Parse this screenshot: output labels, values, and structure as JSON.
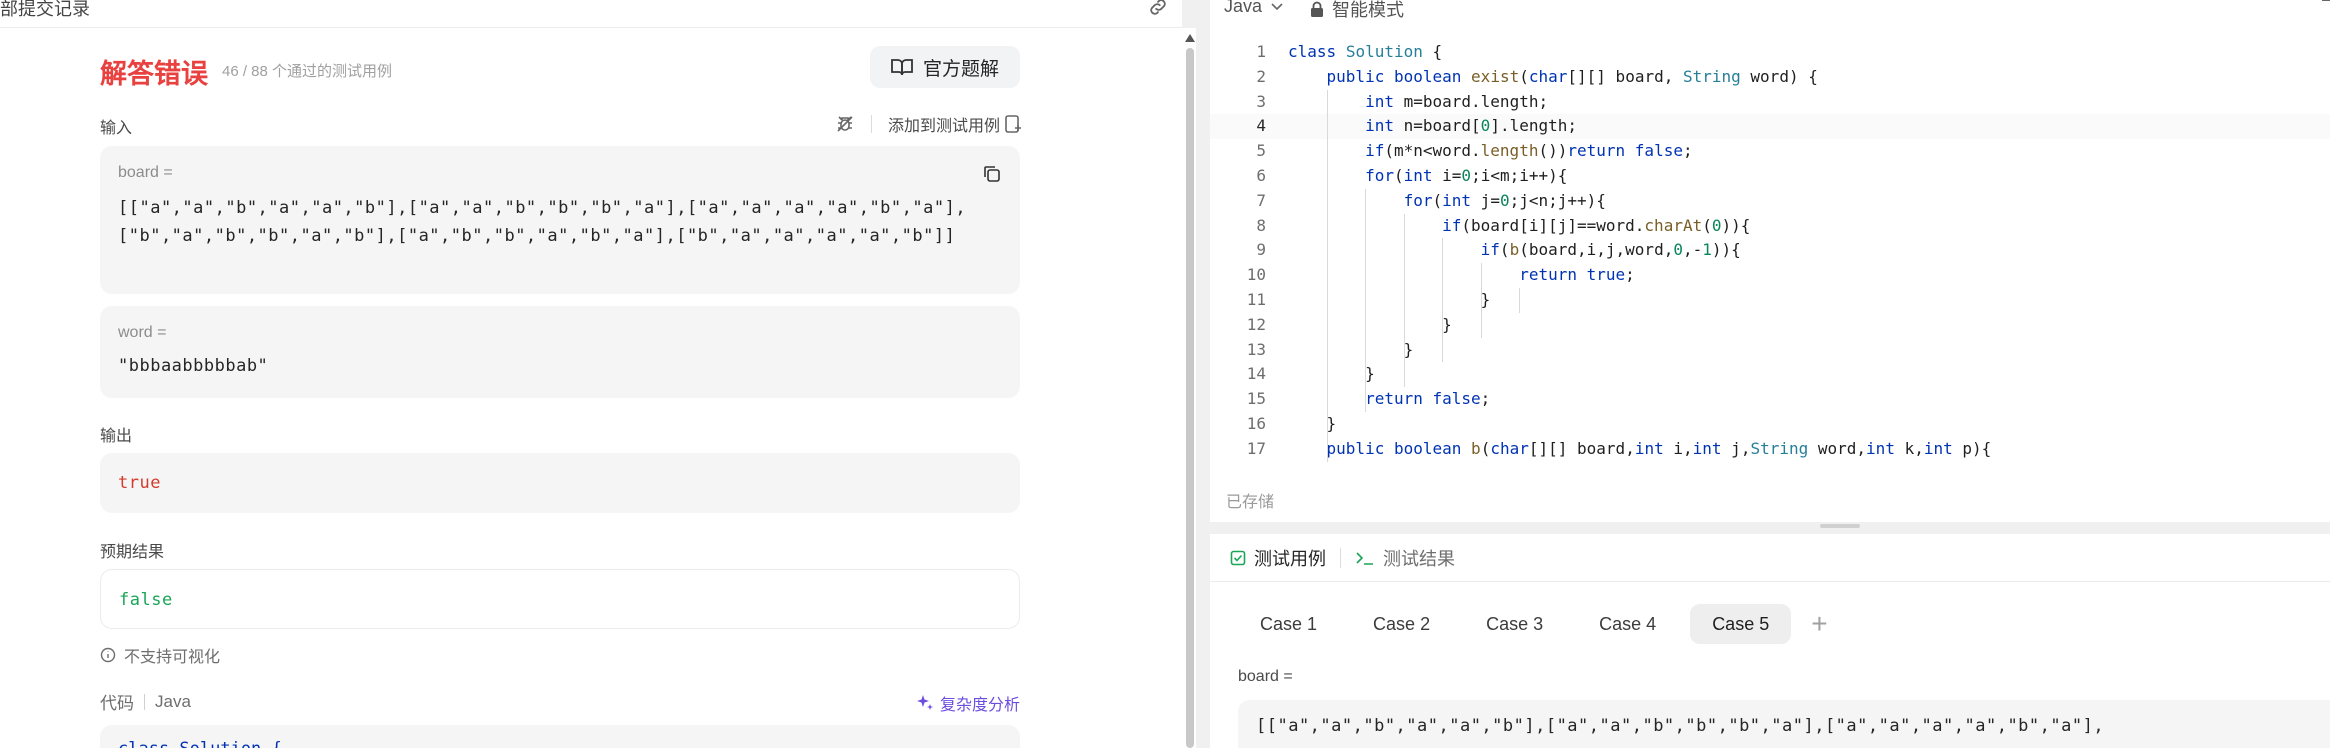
{
  "left": {
    "breadcrumb": "部提交记录",
    "result_title": "解答错误",
    "result_count": "46 / 88 个通过的测试用例",
    "solution_button": "官方题解",
    "input_label": "输入",
    "add_testcase": "添加到测试用例",
    "board_label": "board =",
    "board_value": "[[\"a\",\"a\",\"b\",\"a\",\"a\",\"b\"],[\"a\",\"a\",\"b\",\"b\",\"b\",\"a\"],[\"a\",\"a\",\"a\",\"a\",\"b\",\"a\"],[\"b\",\"a\",\"b\",\"b\",\"a\",\"b\"],[\"a\",\"b\",\"b\",\"a\",\"b\",\"a\"],[\"b\",\"a\",\"a\",\"a\",\"a\",\"b\"]]",
    "word_label": "word =",
    "word_value": "\"bbbaabbbbbab\"",
    "output_label": "输出",
    "output_value": "true",
    "expected_label": "预期结果",
    "expected_value": "false",
    "no_visual": "不支持可视化",
    "code_label": "代码",
    "code_lang": "Java",
    "complexity": "复杂度分析",
    "code_peek": "class Solution {"
  },
  "editor": {
    "language": "Java",
    "mode": "智能模式",
    "saved": "已存储",
    "active_line": 4,
    "lines": [
      {
        "n": "1",
        "html": "<span class=\"kw\">class</span> <span class=\"ty\">Solution</span> {"
      },
      {
        "n": "2",
        "html": "    <span class=\"kw\">public</span> <span class=\"kw\">boolean</span> <span class=\"fn\">exist</span>(<span class=\"kw\">char</span>[][] board, <span class=\"ty\">String</span> word) {"
      },
      {
        "n": "3",
        "html": "        <span class=\"kw\">int</span> m=board.length;"
      },
      {
        "n": "4",
        "html": "        <span class=\"kw\">int</span> n=board[<span class=\"num\">0</span>].length;"
      },
      {
        "n": "5",
        "html": "        <span class=\"kw\">if</span>(m*n&lt;word.<span class=\"fn\">length</span>())<span class=\"kw\">return</span> <span class=\"kw\">false</span>;"
      },
      {
        "n": "6",
        "html": "        <span class=\"kw\">for</span>(<span class=\"kw\">int</span> i=<span class=\"num\">0</span>;i&lt;m;i++){"
      },
      {
        "n": "7",
        "html": "            <span class=\"kw\">for</span>(<span class=\"kw\">int</span> j=<span class=\"num\">0</span>;j&lt;n;j++){"
      },
      {
        "n": "8",
        "html": "                <span class=\"kw\">if</span>(board[i][j]==word.<span class=\"fn\">charAt</span>(<span class=\"num\">0</span>)){"
      },
      {
        "n": "9",
        "html": "                    <span class=\"kw\">if</span>(<span class=\"fn\">b</span>(board,i,j,word,<span class=\"num\">0</span>,-<span class=\"num\">1</span>)){"
      },
      {
        "n": "10",
        "html": "                        <span class=\"kw\">return</span> <span class=\"kw\">true</span>;"
      },
      {
        "n": "11",
        "html": "                    }"
      },
      {
        "n": "12",
        "html": "                }"
      },
      {
        "n": "13",
        "html": "            }"
      },
      {
        "n": "14",
        "html": "        }"
      },
      {
        "n": "15",
        "html": "        <span class=\"kw\">return</span> <span class=\"kw\">false</span>;"
      },
      {
        "n": "16",
        "html": "    }"
      },
      {
        "n": "17",
        "html": "    <span class=\"kw\">public</span> <span class=\"kw\">boolean</span> <span class=\"fn\">b</span>(<span class=\"kw\">char</span>[][] board,<span class=\"kw\">int</span> i,<span class=\"kw\">int</span> j,<span class=\"ty\">String</span> word,<span class=\"kw\">int</span> k,<span class=\"kw\">int</span> p){"
      }
    ]
  },
  "tests": {
    "tab_testcase": "测试用例",
    "tab_result": "测试结果",
    "cases": [
      "Case 1",
      "Case 2",
      "Case 3",
      "Case 4",
      "Case 5"
    ],
    "selected_case": 4,
    "add_case": "+",
    "board_label": "board =",
    "board_value": "[[\"a\",\"a\",\"b\",\"a\",\"a\",\"b\"],[\"a\",\"a\",\"b\",\"b\",\"b\",\"a\"],[\"a\",\"a\",\"a\",\"a\",\"b\",\"a\"],"
  },
  "icons": {
    "link": "link-icon",
    "book": "book-icon",
    "debug": "bug-icon",
    "add_case": "add-testcase-icon",
    "copy": "copy-icon",
    "info": "info-icon",
    "sparkle": "sparkle-icon",
    "chevron": "chevron-down-icon",
    "lock": "lock-icon",
    "checkbox": "checkbox-icon",
    "terminal": "terminal-icon"
  },
  "colors": {
    "error": "#e8413f",
    "output_red": "#d33b2c",
    "expected_green": "#19a657",
    "accent_purple": "#6d4ce0",
    "check_green": "#19a657"
  }
}
